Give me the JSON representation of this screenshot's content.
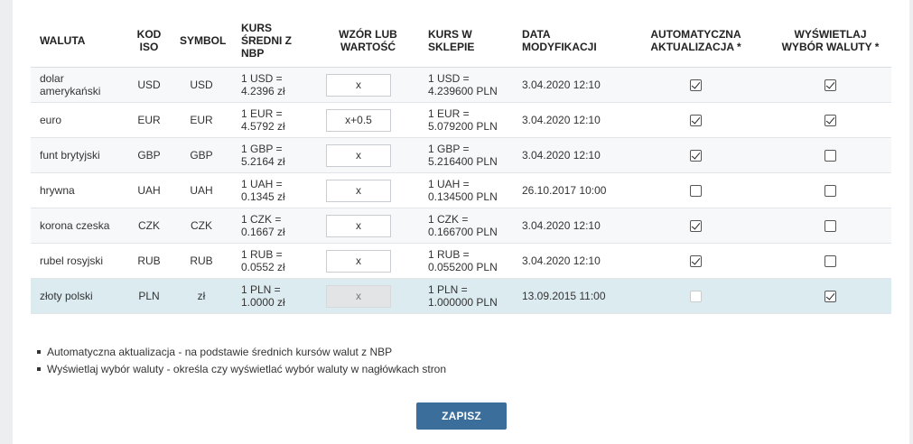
{
  "table": {
    "headers": {
      "currency": "WALUTA",
      "iso": "KOD ISO",
      "symbol": "SYMBOL",
      "nbp_rate": "KURS ŚREDNI Z NBP",
      "formula": "WZÓR LUB WARTOŚĆ",
      "shop_rate": "KURS W SKLEPIE",
      "modified": "DATA MODYFIKACJI",
      "auto_update": "AUTOMATYCZNA AKTUALIZACJA *",
      "show_choice": "WYŚWIETLAJ WYBÓR WALUTY *"
    },
    "rows": [
      {
        "name": "dolar amerykański",
        "iso": "USD",
        "symbol": "USD",
        "nbp_rate": "1 USD = 4.2396 zł",
        "formula": "x",
        "shop_rate": "1 USD = 4.239600 PLN",
        "modified": "3.04.2020 12:10",
        "auto": true,
        "show": true,
        "disabled": false
      },
      {
        "name": "euro",
        "iso": "EUR",
        "symbol": "EUR",
        "nbp_rate": "1 EUR = 4.5792 zł",
        "formula": "x+0.5",
        "shop_rate": "1 EUR = 5.079200 PLN",
        "modified": "3.04.2020 12:10",
        "auto": true,
        "show": true,
        "disabled": false
      },
      {
        "name": "funt brytyjski",
        "iso": "GBP",
        "symbol": "GBP",
        "nbp_rate": "1 GBP = 5.2164 zł",
        "formula": "x",
        "shop_rate": "1 GBP = 5.216400 PLN",
        "modified": "3.04.2020 12:10",
        "auto": true,
        "show": false,
        "disabled": false
      },
      {
        "name": "hrywna",
        "iso": "UAH",
        "symbol": "UAH",
        "nbp_rate": "1 UAH = 0.1345 zł",
        "formula": "x",
        "shop_rate": "1 UAH = 0.134500 PLN",
        "modified": "26.10.2017 10:00",
        "auto": false,
        "show": false,
        "disabled": false
      },
      {
        "name": "korona czeska",
        "iso": "CZK",
        "symbol": "CZK",
        "nbp_rate": "1 CZK = 0.1667 zł",
        "formula": "x",
        "shop_rate": "1 CZK = 0.166700 PLN",
        "modified": "3.04.2020 12:10",
        "auto": true,
        "show": false,
        "disabled": false
      },
      {
        "name": "rubel rosyjski",
        "iso": "RUB",
        "symbol": "RUB",
        "nbp_rate": "1 RUB = 0.0552 zł",
        "formula": "x",
        "shop_rate": "1 RUB = 0.055200 PLN",
        "modified": "3.04.2020 12:10",
        "auto": true,
        "show": false,
        "disabled": false
      },
      {
        "name": "złoty polski",
        "iso": "PLN",
        "symbol": "zł",
        "nbp_rate": "1 PLN = 1.0000 zł",
        "formula": "x",
        "shop_rate": "1 PLN = 1.000000 PLN",
        "modified": "13.09.2015 11:00",
        "auto": false,
        "show": true,
        "disabled": true
      }
    ]
  },
  "notes": [
    "Automatyczna aktualizacja - na podstawie średnich kursów walut z NBP",
    "Wyświetlaj wybór waluty - określa czy wyświetlać wybór waluty w nagłówkach stron"
  ],
  "save_label": "ZAPISZ",
  "colors": {
    "save_button": "#3c6e9c",
    "highlight_row": "#dcebf0",
    "page_bg": "#eceeef"
  }
}
